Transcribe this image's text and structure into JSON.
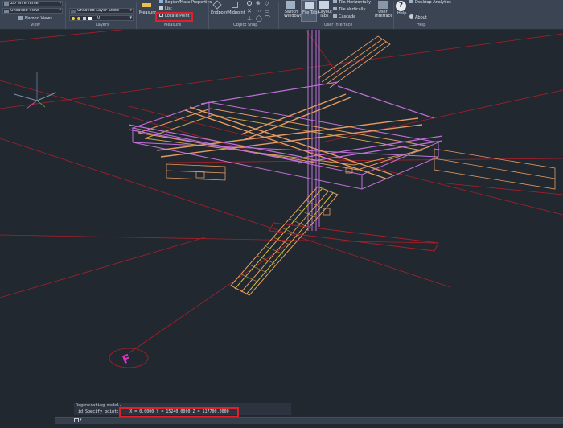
{
  "ribbon": {
    "view_panel": {
      "title": "View",
      "visual_style": "2D Wireframe",
      "saved_view": "Unsaved View",
      "named_views": "Named Views"
    },
    "layers_panel": {
      "title": "Layers",
      "layer_state": "Unsaved Layer State",
      "current_layer": "0"
    },
    "measure_panel": {
      "title": "Measure",
      "measure_label": "Measure",
      "region_mass": "Region/Mass Properties",
      "list": "List",
      "locate_point": "Locate Point"
    },
    "osnap_panel": {
      "title": "Object Snap",
      "endpoint": "Endpoint",
      "midpoint": "Midpoint"
    },
    "ui_panel": {
      "title": "User Interface",
      "switch_windows": "Switch Windows",
      "file_tabs": "File Tabs",
      "layout_tabs": "Layout Tabs",
      "tile_horizontally": "Tile Horizontally",
      "tile_vertically": "Tile Vertically",
      "cascade": "Cascade",
      "user_interface": "User Interface"
    },
    "help_panel": {
      "title": "Help",
      "help": "Help",
      "desktop_analytics": "Desktop Analytics",
      "about": "About"
    }
  },
  "command": {
    "history": "Regenerating model.",
    "prompt_prefix": "_id Specify point:",
    "coords": "X = 0.0000      Y = 15240.0000      Z = 117700.0000"
  },
  "viewport": {
    "marker_label": "F"
  },
  "colors": {
    "highlight": "#e0202a",
    "background": "#212830",
    "steel": "#c070d8",
    "timber": "#e49a62"
  }
}
